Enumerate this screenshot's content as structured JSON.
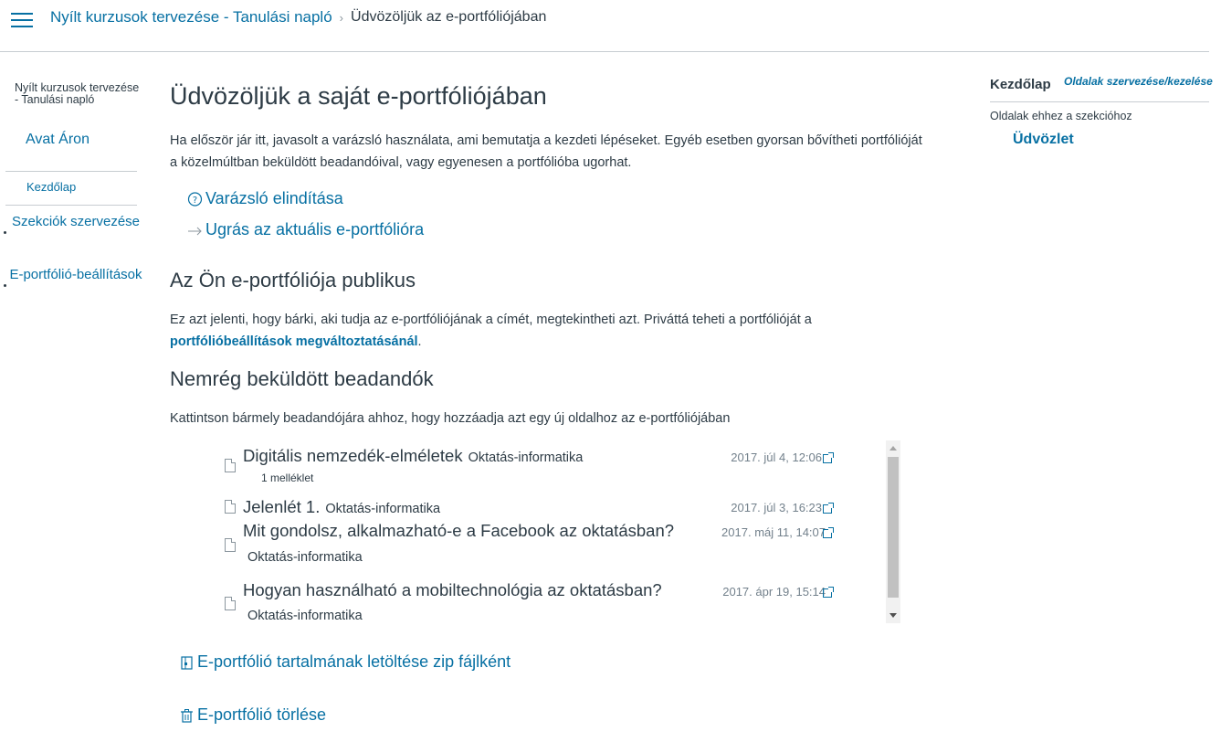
{
  "header": {
    "course_link": "Nyílt kurzusok tervezése - Tanulási napló",
    "separator": "›",
    "current_page": "Üdvözöljük az e-portfóliójában"
  },
  "leftnav": {
    "course_name": "Nyílt kurzusok tervezése - Tanulási napló",
    "user_name": "Avat Áron",
    "home": "Kezdőlap",
    "items": [
      {
        "label": "Szekciók szervezése"
      },
      {
        "label": "E-portfólió-beállítások"
      }
    ]
  },
  "main": {
    "title": "Üdvözöljük a saját e-portfóliójában",
    "intro": "Ha először jár itt, javasolt a varázsló használata, ami bemutatja a kezdeti lépéseket. Egyéb esetben gyorsan bővítheti portfólióját a közelmúltban beküldött beadandóival, vagy egyenesen a portfólióba ugorhat.",
    "wizard_link": "Varázsló elindítása",
    "goto_link": "Ugrás az aktuális e-portfólióra",
    "public_heading": "Az Ön e-portfóliója publikus",
    "public_text": "Ez azt jelenti, hogy bárki, aki tudja az e-portfóliójának a címét, megtekintheti azt. Priváttá teheti a portfólióját a",
    "public_link": "portfólióbeállítások megváltoztatásánál",
    "public_end": ".",
    "recent_heading": "Nemrég beküldött beadandók",
    "recent_text": "Kattintson bármely beadandójára ahhoz, hogy hozzáadja azt egy új oldalhoz az e-portfóliójában",
    "submissions": [
      {
        "title": "Digitális nemzedék-elméletek",
        "course": "Oktatás-informatika",
        "date": "2017. júl 4, 12:06",
        "attachment": "1 melléklet"
      },
      {
        "title": "Jelenlét 1.",
        "course": "Oktatás-informatika",
        "date": "2017. júl 3, 16:23"
      },
      {
        "title": "Mit gondolsz, alkalmazható-e a Facebook az oktatásban?",
        "course": "Oktatás-informatika",
        "date": "2017. máj 11, 14:07"
      },
      {
        "title": "Hogyan használható a mobiltechnológia az oktatásban?",
        "course": "Oktatás-informatika",
        "date": "2017. ápr 19, 15:14"
      }
    ],
    "download_link": "E-portfólió tartalmának letöltése zip fájlként",
    "delete_link": "E-portfólió törlése"
  },
  "rightbar": {
    "title": "Kezdőlap",
    "manage_link": "Oldalak szervezése/kezelése",
    "subtitle": "Oldalak ehhez a szekcióhoz",
    "page": "Üdvözlet"
  },
  "colors": {
    "link": "#0770a3",
    "text": "#2d3b45",
    "muted": "#73818c",
    "border": "#c7cdd1"
  },
  "icons": {
    "menu": "hamburger-icon",
    "wizard": "question-circle-icon",
    "goto": "arrow-right-icon",
    "document": "document-icon",
    "external": "external-link-icon",
    "download": "zip-file-icon",
    "delete": "trash-icon"
  }
}
